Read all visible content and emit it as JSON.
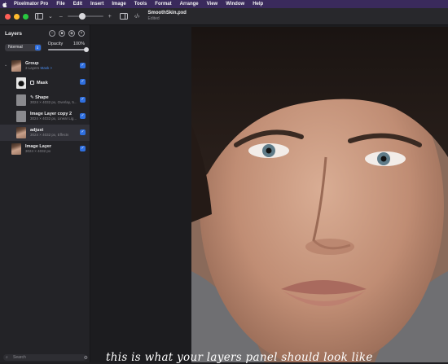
{
  "menubar": {
    "app_name": "Pixelmator Pro",
    "items": [
      "File",
      "Edit",
      "Insert",
      "Image",
      "Tools",
      "Format",
      "Arrange",
      "View",
      "Window",
      "Help"
    ]
  },
  "toolbar": {
    "doc_name": "SmoothSkin.pxd",
    "doc_status": "Edited"
  },
  "sidebar": {
    "title": "Layers",
    "blend_mode": "Normal",
    "opacity_label": "Opacity",
    "opacity_value": "100%",
    "opacity_fraction": 1.0,
    "layers": [
      {
        "name": "Group",
        "meta": "3 Layers",
        "meta_accent": "Mask >"
      },
      {
        "name": "Mask",
        "meta": ""
      },
      {
        "name": "Shape",
        "meta": "3024 × 4032 px, Overlay, 5..."
      },
      {
        "name": "Image Layer copy 2",
        "meta": "3024 × 4032 px, Linear Lig..."
      },
      {
        "name": "adjust",
        "meta": "3024 × 4032 px, Effects"
      },
      {
        "name": "Image Layer",
        "meta": "3024 × 4032 px"
      }
    ],
    "search_placeholder": "Search"
  },
  "canvas": {
    "caption": "this is what your layers panel should look like"
  },
  "colors": {
    "menubar": "#3a2a5c",
    "accent": "#2f6fdf",
    "close": "#ff5f57",
    "minimize": "#febc2e",
    "zoom": "#28c840"
  }
}
